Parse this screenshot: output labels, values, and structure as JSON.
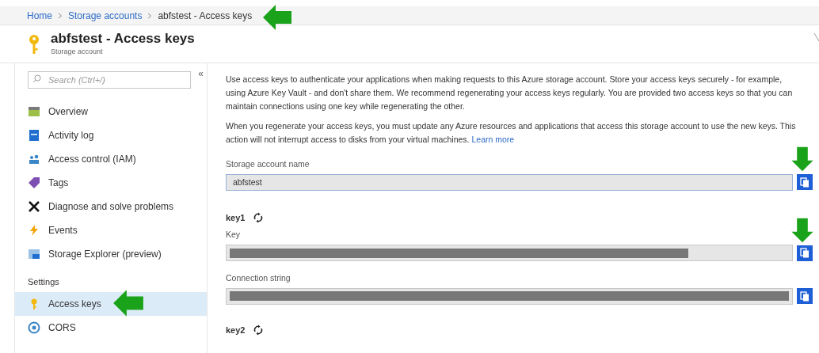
{
  "breadcrumb": [
    {
      "label": "Home",
      "link": true
    },
    {
      "label": "Storage accounts",
      "link": true
    },
    {
      "label": "abfstest - Access keys",
      "link": false
    }
  ],
  "header": {
    "title": "abfstest - Access keys",
    "subtitle": "Storage account"
  },
  "sidebar": {
    "search": {
      "placeholder": "Search (Ctrl+/)"
    },
    "collapse": "«",
    "items": [
      {
        "label": "Overview",
        "selected": false
      },
      {
        "label": "Activity log",
        "selected": false
      },
      {
        "label": "Access control (IAM)",
        "selected": false
      },
      {
        "label": "Tags",
        "selected": false
      },
      {
        "label": "Diagnose and solve problems",
        "selected": false
      },
      {
        "label": "Events",
        "selected": false
      },
      {
        "label": "Storage Explorer (preview)",
        "selected": false
      }
    ],
    "section": "Settings",
    "settings_items": [
      {
        "label": "Access keys",
        "selected": true
      },
      {
        "label": "CORS",
        "selected": false
      }
    ]
  },
  "intro": "Use access keys to authenticate your applications when making requests to this Azure storage account. Store your access keys securely - for example, using Azure Key Vault - and don't share them. We recommend regenerating your access keys regularly. You are provided two access keys so that you can maintain connections using one key while regenerating the other.",
  "notice": {
    "text": "When you regenerate your access keys, you must update any Azure resources and applications that access this storage account to use the new keys. This action will not interrupt access to disks from your virtual machines.",
    "link": "Learn more"
  },
  "account_name": {
    "label": "Storage account name",
    "value": "abfstest"
  },
  "keys": [
    {
      "title": "key1",
      "fields": [
        {
          "label": "Key",
          "redacted": true
        },
        {
          "label": "Connection string",
          "redacted": true
        }
      ]
    },
    {
      "title": "key2"
    }
  ]
}
